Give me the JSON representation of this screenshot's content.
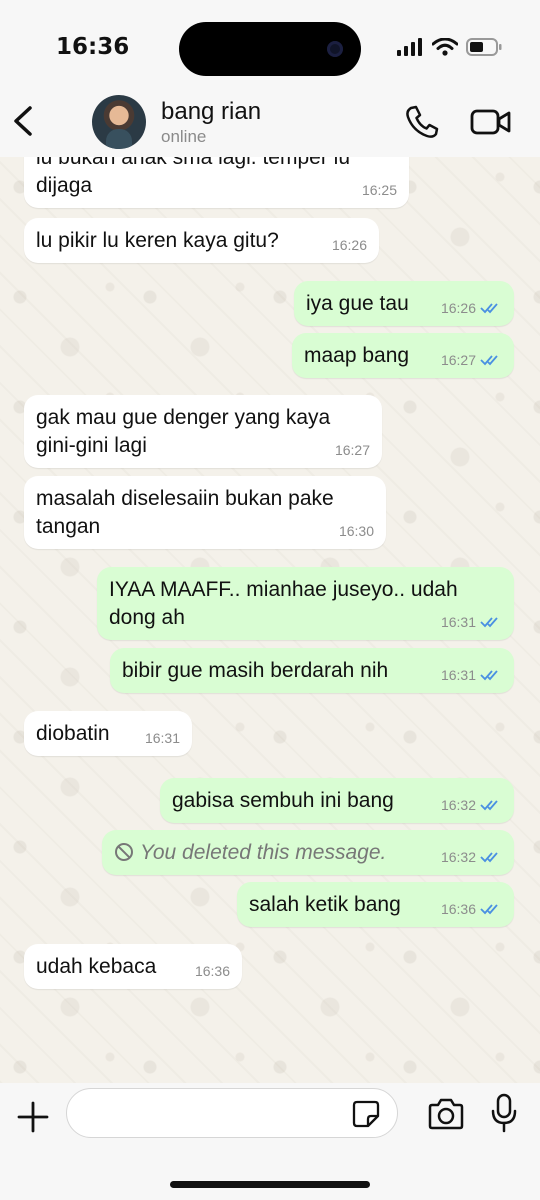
{
  "status_bar": {
    "time": "16:36"
  },
  "header": {
    "contact_name": "bang rian",
    "contact_status": "online"
  },
  "messages": [
    {
      "dir": "in",
      "text": "lu bukan anak sma lagi. temper lu dijaga",
      "time": "16:25"
    },
    {
      "dir": "in",
      "text": "lu pikir lu keren kaya gitu?",
      "time": "16:26"
    },
    {
      "dir": "out",
      "text": "iya gue tau",
      "time": "16:26",
      "read": true
    },
    {
      "dir": "out",
      "text": "maap bang",
      "time": "16:27",
      "read": true
    },
    {
      "dir": "in",
      "text": "gak mau gue denger yang kaya gini-gini lagi",
      "time": "16:27"
    },
    {
      "dir": "in",
      "text": "masalah diselesaiin bukan pake tangan",
      "time": "16:30"
    },
    {
      "dir": "out",
      "text": "IYAA MAAFF.. mianhae juseyo.. udah dong ah",
      "time": "16:31",
      "read": true
    },
    {
      "dir": "out",
      "text": "bibir gue masih berdarah nih",
      "time": "16:31",
      "read": true
    },
    {
      "dir": "in",
      "text": "diobatin",
      "time": "16:31"
    },
    {
      "dir": "out",
      "text": "gabisa sembuh ini bang",
      "time": "16:32",
      "read": true
    },
    {
      "dir": "out",
      "text": "You deleted this message.",
      "time": "16:32",
      "read": true,
      "deleted": true
    },
    {
      "dir": "out",
      "text": "salah ketik bang",
      "time": "16:36",
      "read": true
    },
    {
      "dir": "in",
      "text": "udah kebaca",
      "time": "16:36"
    }
  ],
  "input": {
    "placeholder": ""
  },
  "colors": {
    "outgoing_bubble": "#d9fdd3",
    "incoming_bubble": "#ffffff",
    "read_ticks": "#4a90e2",
    "chat_bg": "#f4f1ea"
  },
  "icons": [
    "back-icon",
    "phone-icon",
    "video-icon",
    "plus-icon",
    "sticker-icon",
    "camera-icon",
    "mic-icon",
    "double-check-icon",
    "deleted-icon"
  ]
}
